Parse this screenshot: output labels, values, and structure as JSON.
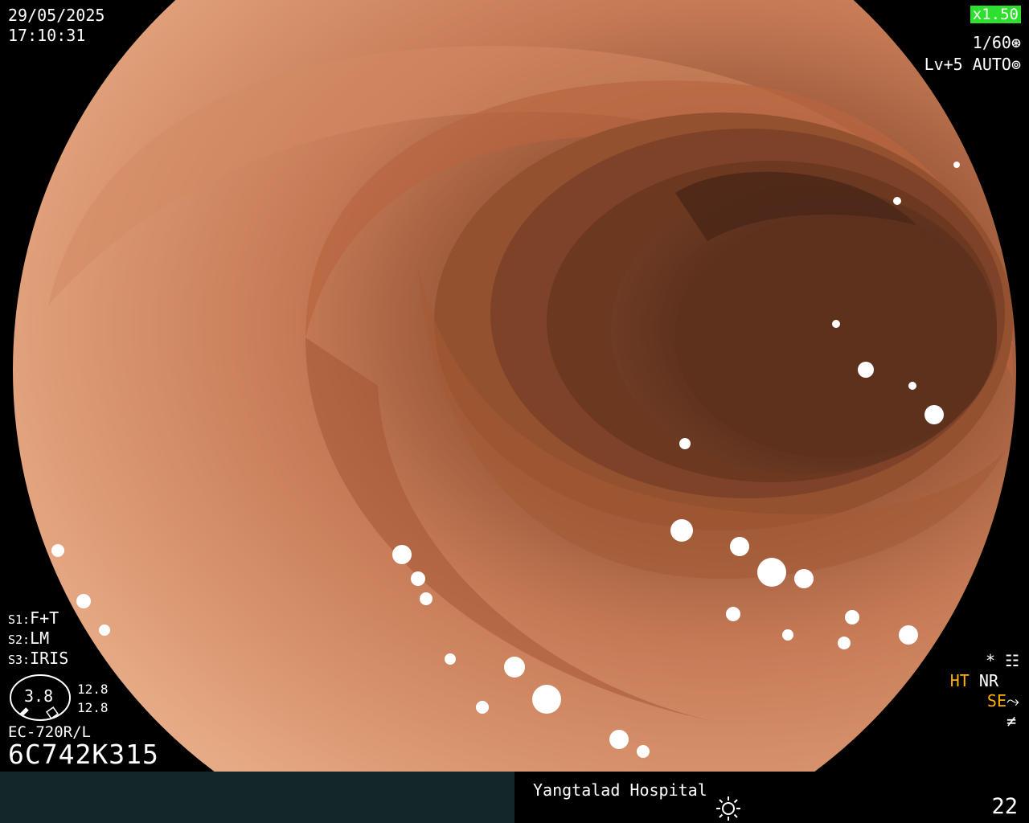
{
  "header": {
    "date": "29/05/2025",
    "time": "17:10:31",
    "zoom": "x1.50",
    "shutter": "1/60",
    "level": "Lv+5",
    "mode": "AUTO"
  },
  "settings": {
    "s1_prefix": "S1:",
    "s1_value": "F+T",
    "s2_prefix": "S2:",
    "s2_value": "LM",
    "s3_prefix": "S3:",
    "s3_value": "IRIS"
  },
  "gauge": {
    "value": "3.8",
    "top": "12.8",
    "bottom": "12.8"
  },
  "scope": {
    "model": "EC-720R/L",
    "serial": "6C742K315"
  },
  "indicators": {
    "star": "*",
    "ht": "HT",
    "nr": "NR",
    "se": "SE",
    "icons": [
      "settings-sliders-icon",
      "tone-curve-icon",
      "freeze-icon",
      "sun-icon",
      "aperture-icon",
      "iris-icon"
    ]
  },
  "footer": {
    "hospital": "Yangtalad Hospital",
    "frame_number": "22"
  },
  "colors": {
    "zoom_bg": "#2ee02e",
    "accent_orange": "#ffb000",
    "bar_left": "#13272a"
  }
}
